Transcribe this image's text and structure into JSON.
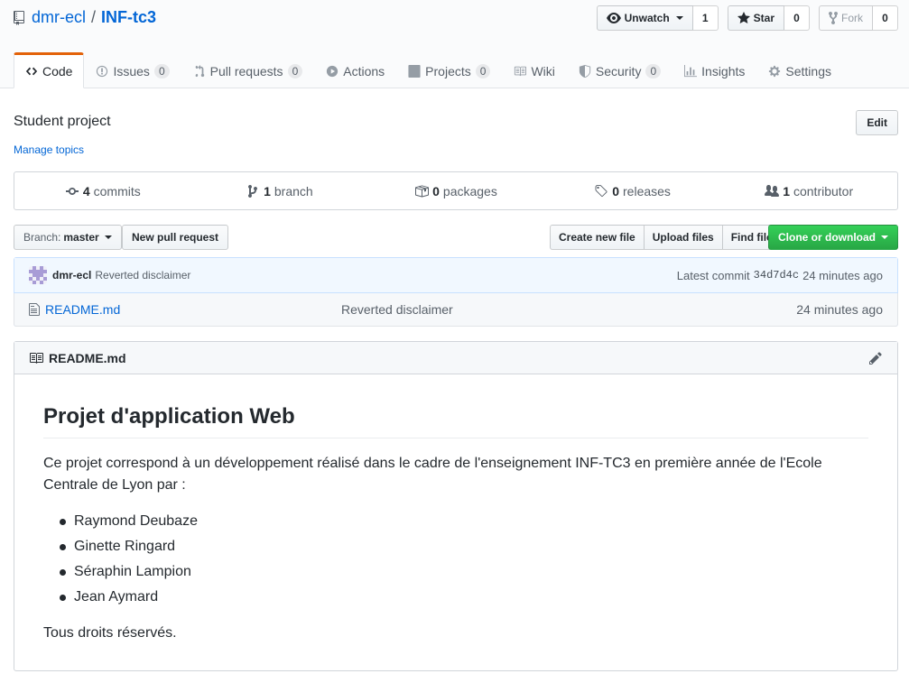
{
  "repo": {
    "owner": "dmr-ecl",
    "separator": "/",
    "name": "INF-tc3"
  },
  "actions": {
    "watch_label": "Unwatch",
    "watch_count": "1",
    "star_label": "Star",
    "star_count": "0",
    "fork_label": "Fork",
    "fork_count": "0"
  },
  "tabs": [
    {
      "label": "Code",
      "icon": "code-icon"
    },
    {
      "label": "Issues",
      "count": "0",
      "icon": "issue-icon"
    },
    {
      "label": "Pull requests",
      "count": "0",
      "icon": "pull-request-icon"
    },
    {
      "label": "Actions",
      "icon": "play-icon"
    },
    {
      "label": "Projects",
      "count": "0",
      "icon": "project-icon"
    },
    {
      "label": "Wiki",
      "icon": "book-icon"
    },
    {
      "label": "Security",
      "count": "0",
      "icon": "shield-icon"
    },
    {
      "label": "Insights",
      "icon": "graph-icon"
    },
    {
      "label": "Settings",
      "icon": "gear-icon"
    }
  ],
  "description": "Student project",
  "manage_topics": "Manage topics",
  "edit_label": "Edit",
  "summary": {
    "commits_num": "4",
    "commits_label": "commits",
    "branch_num": "1",
    "branch_label": "branch",
    "packages_num": "0",
    "packages_label": "packages",
    "releases_num": "0",
    "releases_label": "releases",
    "contributor_num": "1",
    "contributor_label": "contributor"
  },
  "file_nav": {
    "branch_prefix": "Branch:",
    "branch_name": "master",
    "new_pr": "New pull request",
    "create_file": "Create new file",
    "upload_files": "Upload files",
    "find_file": "Find file",
    "clone": "Clone or download"
  },
  "commit": {
    "author": "dmr-ecl",
    "message": "Reverted disclaimer",
    "latest_label": "Latest commit",
    "sha": "34d7d4c",
    "age": "24 minutes ago"
  },
  "files": [
    {
      "name": "README.md",
      "message": "Reverted disclaimer",
      "age": "24 minutes ago"
    }
  ],
  "readme": {
    "filename": "README.md",
    "heading": "Projet d'application Web",
    "intro": "Ce projet correspond à un développement réalisé dans le cadre de l'enseignement INF-TC3 en première année de l'Ecole Centrale de Lyon par :",
    "people": [
      "Raymond Deubaze",
      "Ginette Ringard",
      "Séraphin Lampion",
      "Jean Aymard"
    ],
    "footer": "Tous droits réservés."
  },
  "colors": {
    "link": "#0366d6",
    "accent_tab": "#e36209",
    "green_button": "#28a745"
  }
}
